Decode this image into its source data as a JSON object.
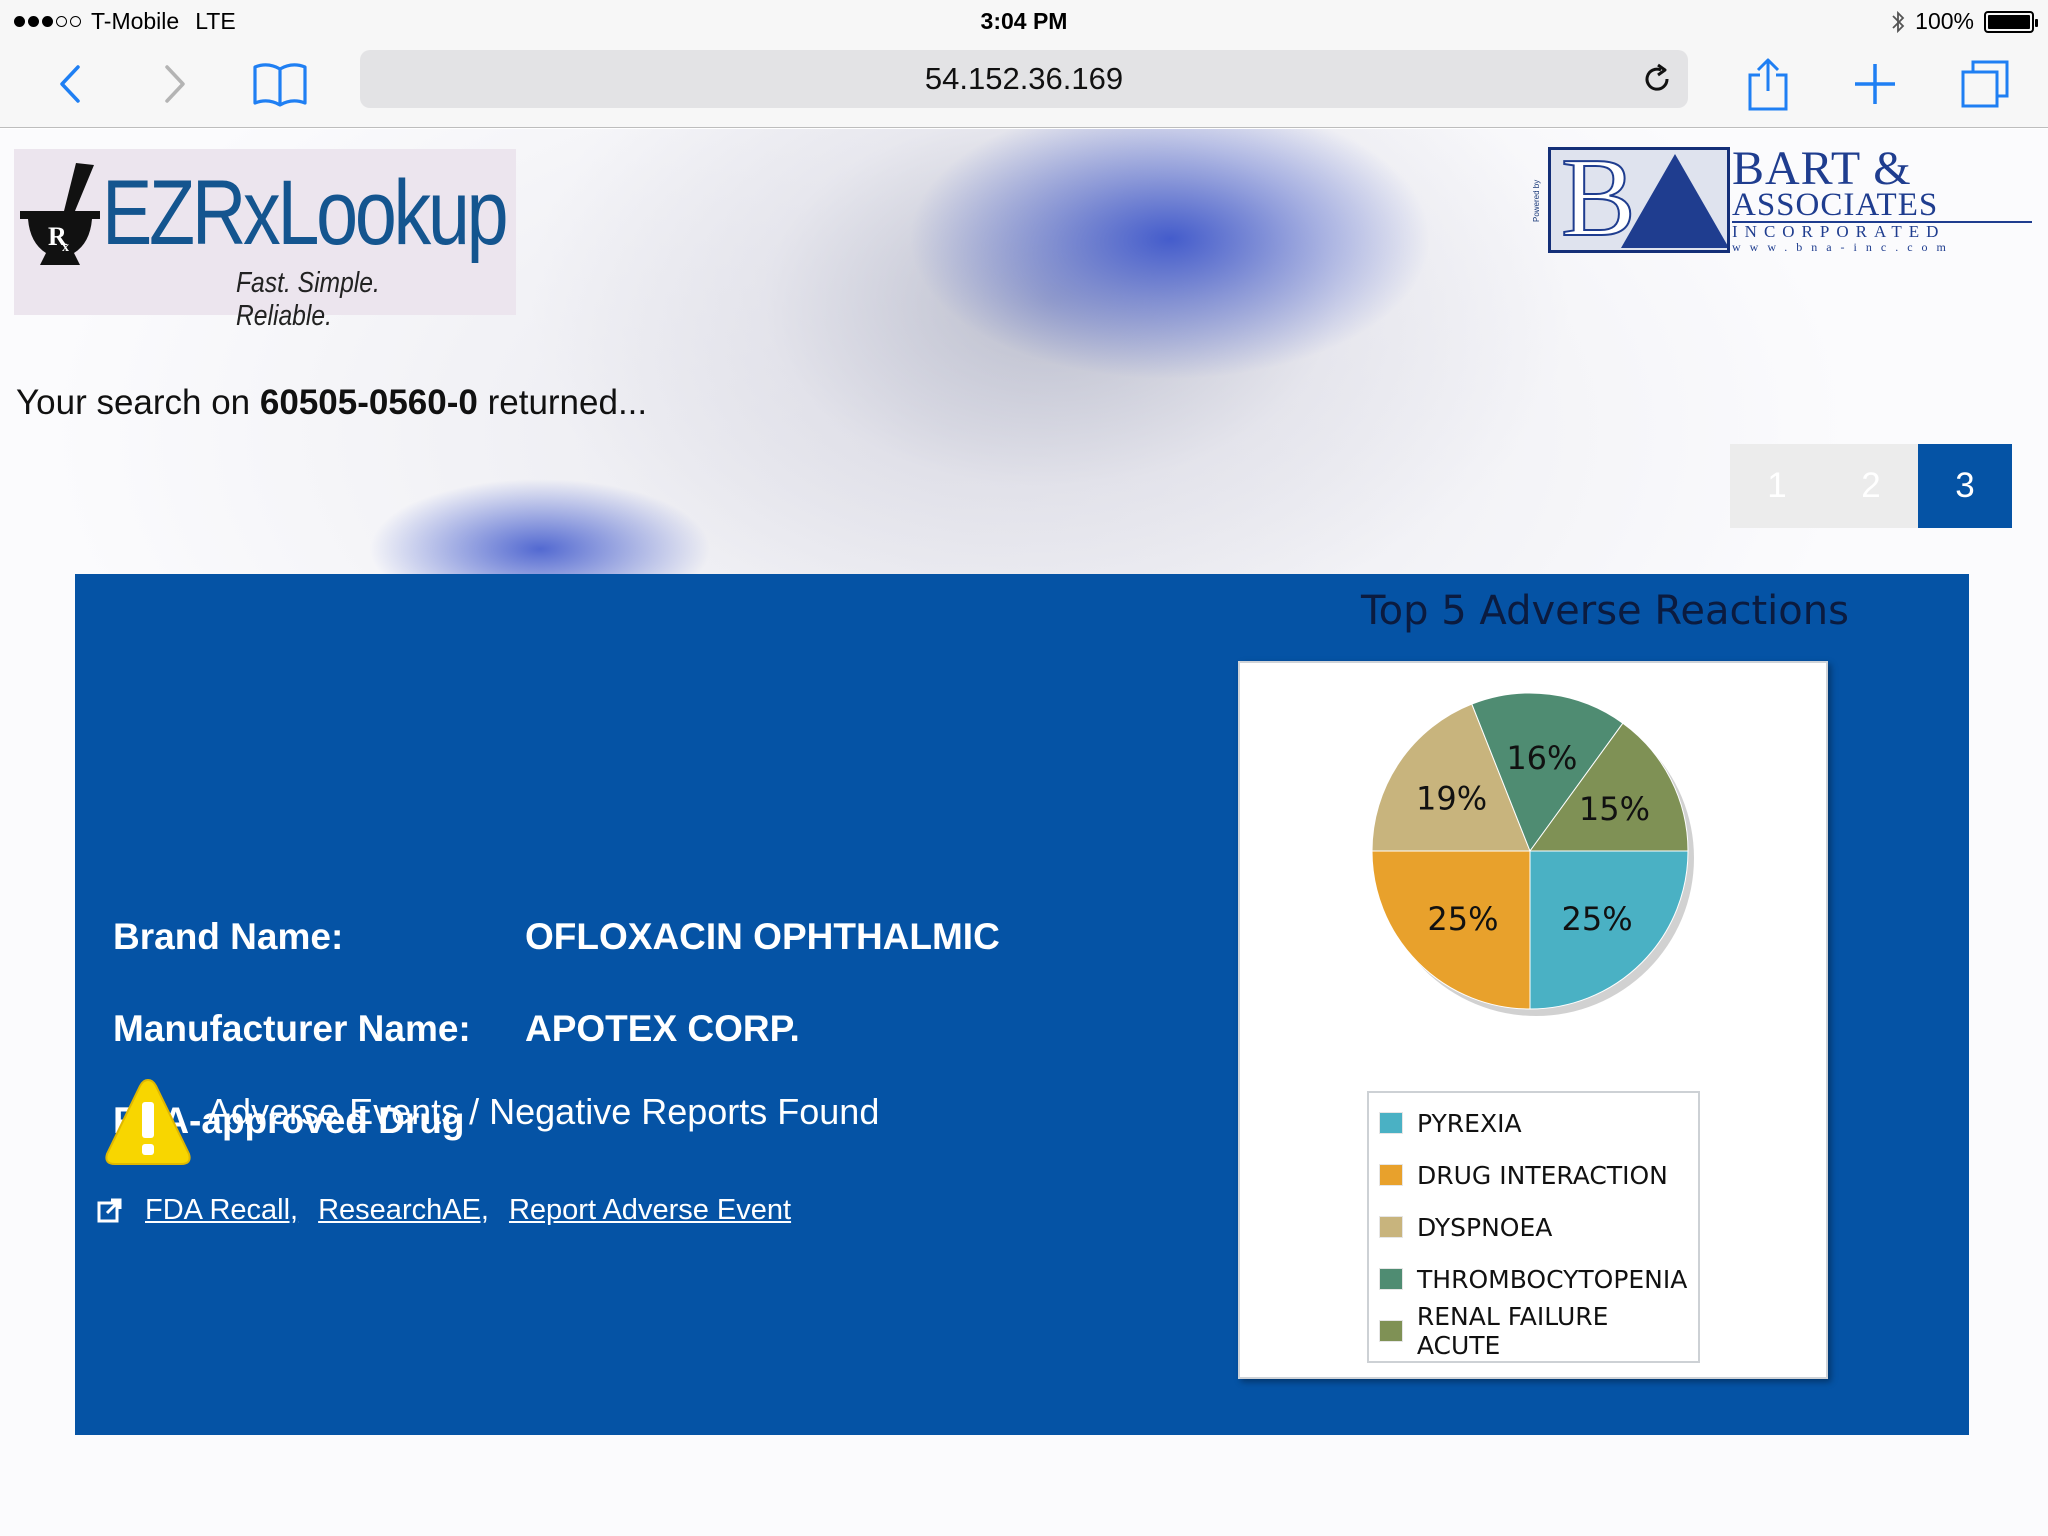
{
  "status": {
    "carrier": "T-Mobile",
    "network": "LTE",
    "time": "3:04 PM",
    "battery": "100%"
  },
  "browser": {
    "url": "54.152.36.169"
  },
  "logo": {
    "name": "EZRxLookup",
    "tagline": "Fast. Simple. Reliable.",
    "partner_powered": "Powered by",
    "partner_line1": "BART &",
    "partner_line2": "ASSOCIATES",
    "partner_line3": "INCORPORATED",
    "partner_line4": "www.bna-inc.com"
  },
  "search": {
    "prefix": "Your search on",
    "code": "60505-0560-0",
    "suffix": "returned..."
  },
  "pagination": {
    "pages": [
      "1",
      "2",
      "3"
    ],
    "active": "3"
  },
  "drug": {
    "brand_label": "Brand Name:",
    "brand_value": "OFLOXACIN OPHTHALMIC",
    "manufacturer_label": "Manufacturer Name:",
    "manufacturer_value": "APOTEX CORP.",
    "approval": "FDA-approved Drug",
    "warning": "Adverse Events / Negative Reports Found",
    "links": [
      "FDA Recall,",
      "ResearchAE,",
      "Report Adverse Event"
    ]
  },
  "icons": {
    "warning": "warning-triangle-icon",
    "external_link": "external-link-icon"
  },
  "colors": {
    "panel": "#0553a5",
    "page_active": "#0553a5"
  },
  "chart_data": {
    "type": "pie",
    "title": "Top 5 Adverse Reactions",
    "categories": [
      "PYREXIA",
      "DRUG INTERACTION",
      "DYSPNOEA",
      "THROMBOCYTOPENIA",
      "RENAL FAILURE ACUTE"
    ],
    "values": [
      25,
      25,
      19,
      16,
      15
    ],
    "labels": [
      "25%",
      "25%",
      "19%",
      "16%",
      "15%"
    ],
    "colors": [
      "#4ab1c4",
      "#e8a12c",
      "#c8b47d",
      "#4f8c72",
      "#7f9155"
    ],
    "legend": "bottom"
  }
}
